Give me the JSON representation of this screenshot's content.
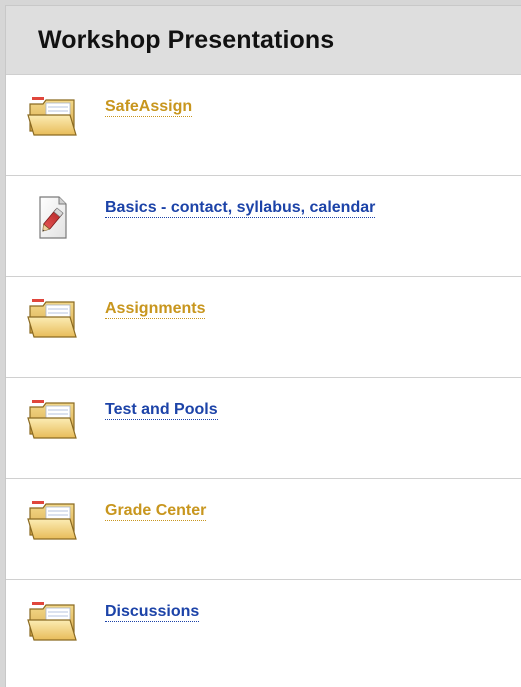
{
  "page": {
    "title": "Workshop Presentations"
  },
  "colors": {
    "header_bg": "#dedede",
    "link_gold": "#c8961e",
    "link_blue": "#1c43a8"
  },
  "items": [
    {
      "label": "SafeAssign",
      "icon": "folder-icon",
      "link_color": "#c8961e"
    },
    {
      "label": "Basics - contact, syllabus, calendar",
      "icon": "file-attachment-icon",
      "link_color": "#1c43a8"
    },
    {
      "label": "Assignments",
      "icon": "folder-icon",
      "link_color": "#c8961e"
    },
    {
      "label": "Test and Pools",
      "icon": "folder-icon",
      "link_color": "#1c43a8"
    },
    {
      "label": "Grade Center",
      "icon": "folder-icon",
      "link_color": "#c8961e"
    },
    {
      "label": "Discussions",
      "icon": "folder-icon",
      "link_color": "#1c43a8"
    }
  ]
}
